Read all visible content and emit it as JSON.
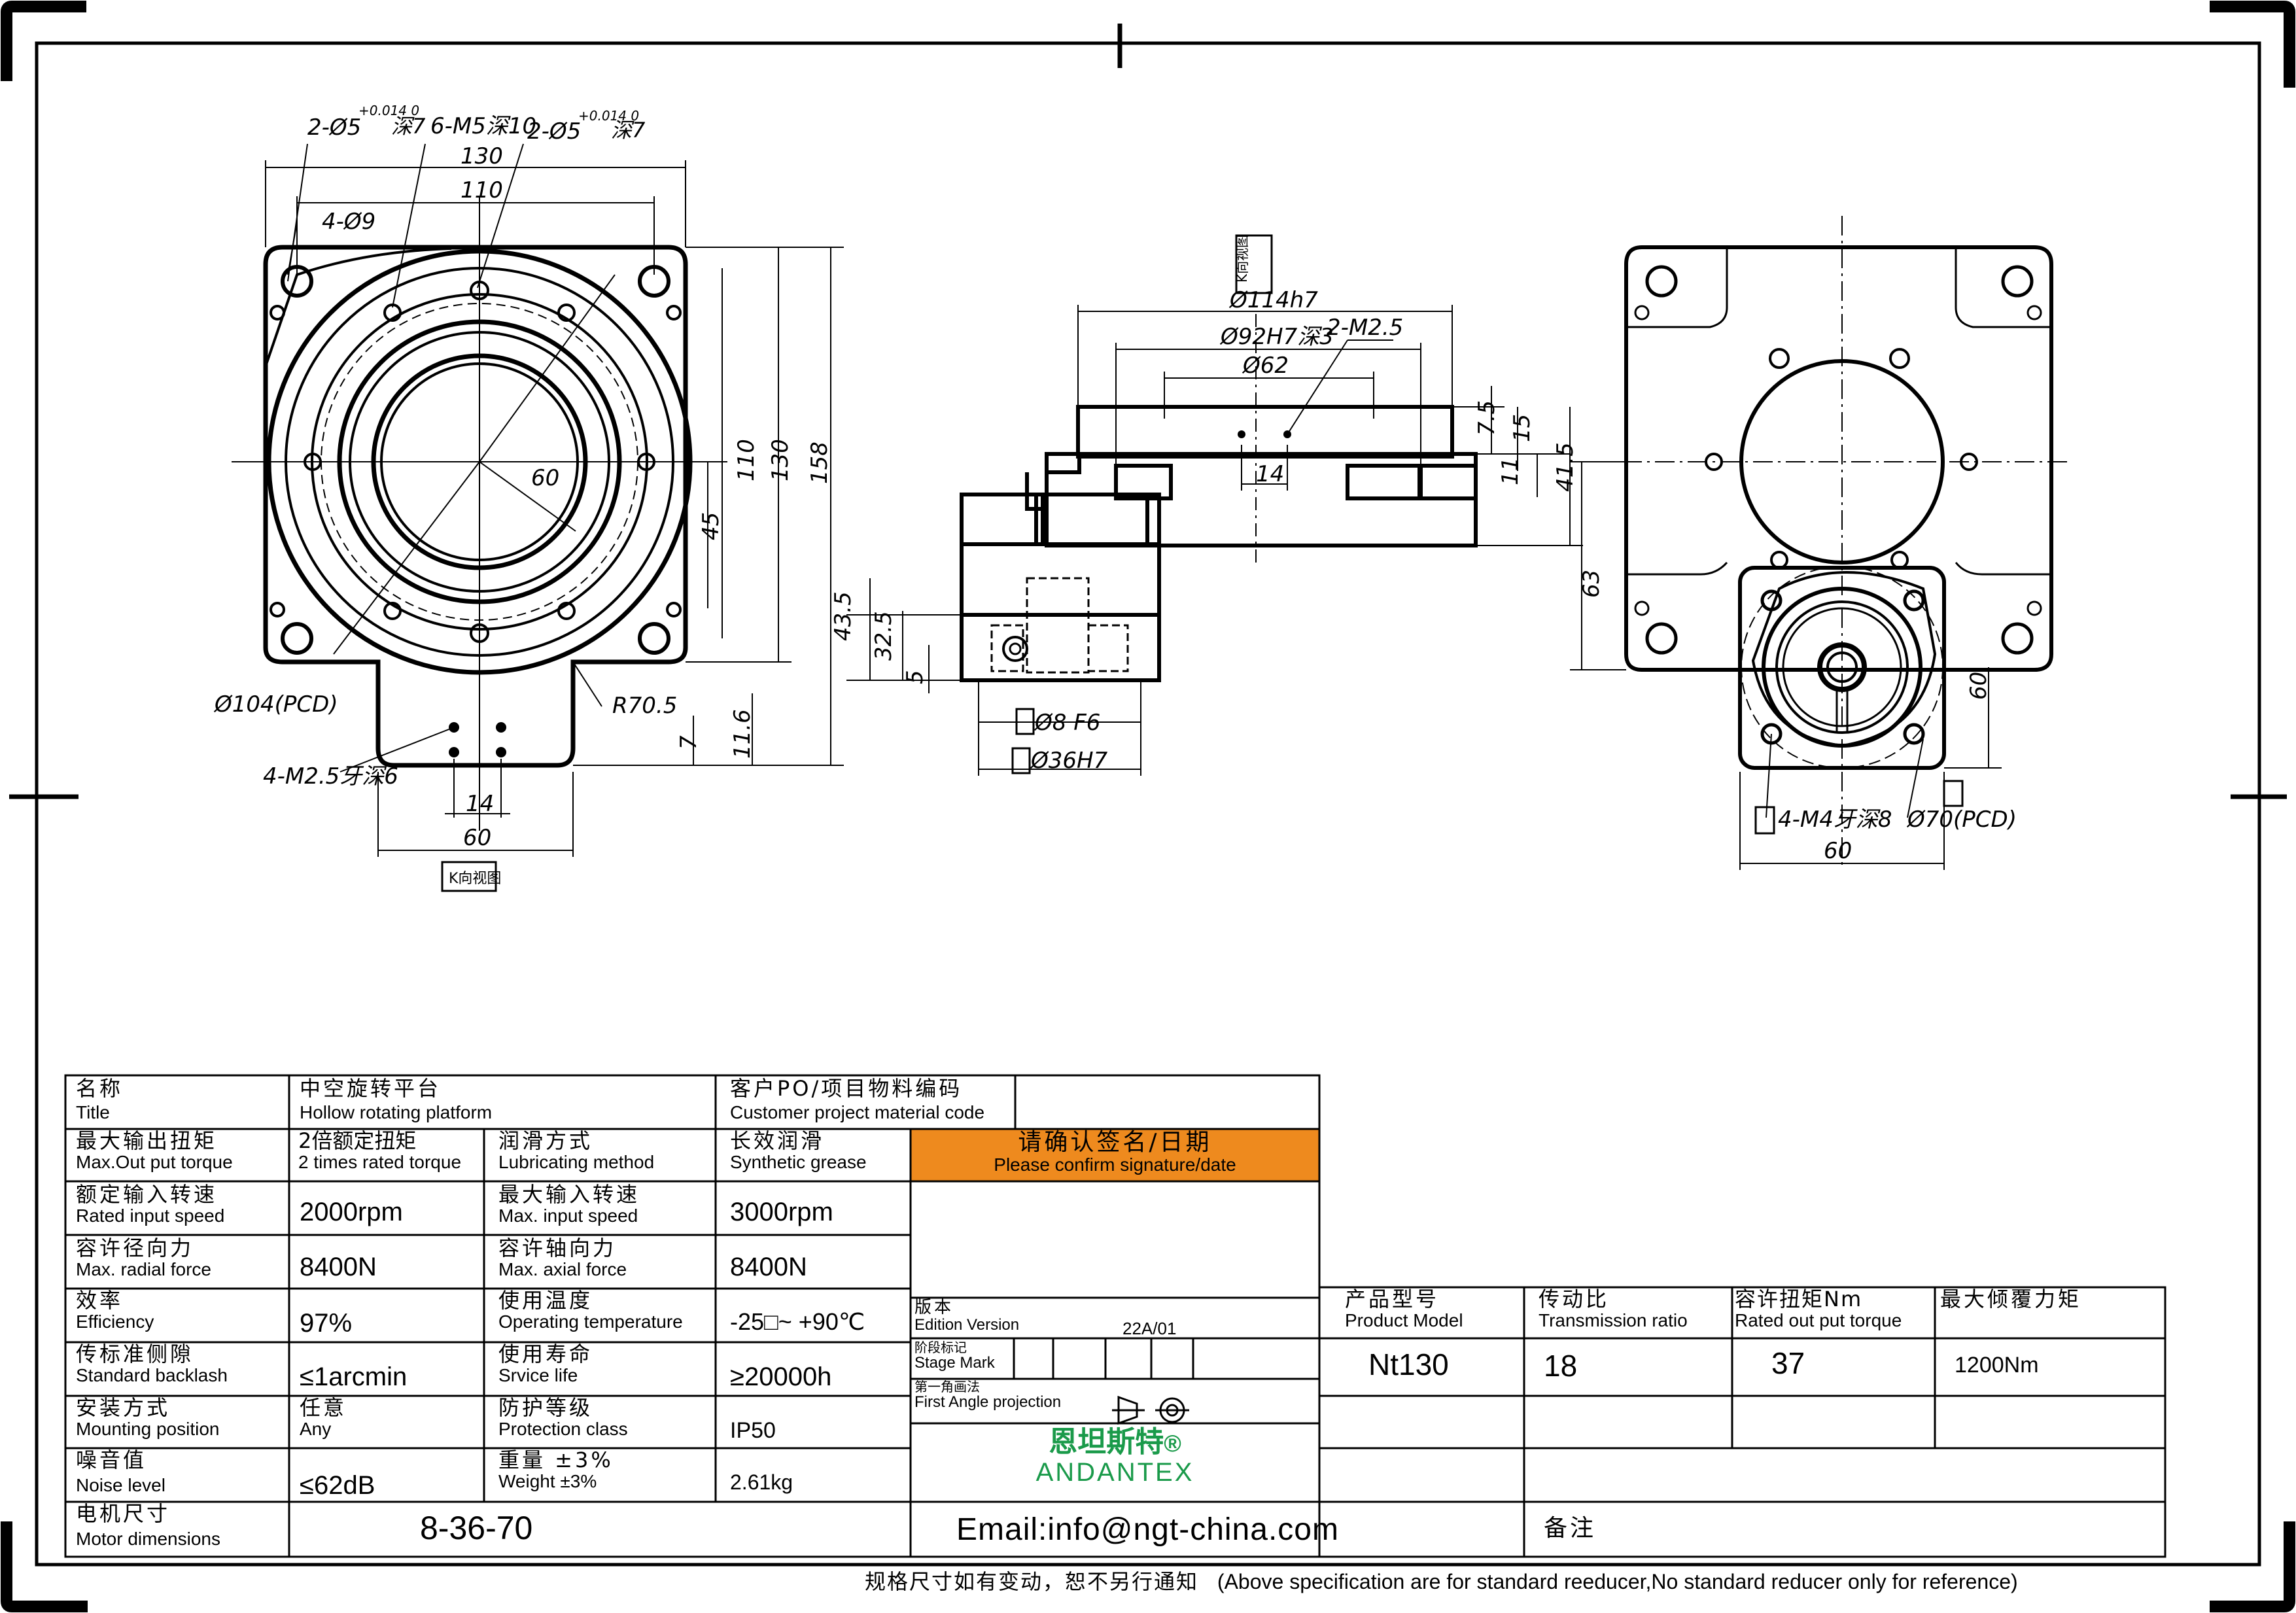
{
  "drawing_labels": {
    "hole_a": "2-Ø5",
    "hole_a_tol": "+0.014 0",
    "hole_a_depth": "深7",
    "tap_top": "6-M5深10",
    "hole_b": "2-Ø5",
    "hole_b_tol": "+0.014 0",
    "hole_b_depth": "深7",
    "dim_130_top": "130",
    "dim_110_top": "110",
    "holes_4": "4-Ø9",
    "angle_60": "60",
    "dim_45": "45",
    "dim_110_right": "110",
    "dim_130_right": "130",
    "dim_158": "158",
    "pcd_104": "Ø104(PCD)",
    "r70": "R70.5",
    "tap_m25": "4-M2.5牙深6",
    "dim_7": "7",
    "dim_11_6": "11.6",
    "dim_14_bottom": "14",
    "dim_60_bottom": "60",
    "k_view": "K向视图",
    "k_marker": "K向视图",
    "d114": "Ø114h7",
    "d92": "Ø92H7深3",
    "m25_side": "2-M2.5",
    "d62": "Ø62",
    "dim_7_5": "7.5",
    "dim_15": "15",
    "dim_11": "11",
    "dim_41_5": "41.5",
    "dim_14_side": "14",
    "dim_43_5": "43.5",
    "dim_32_5": "32.5",
    "dim_5": "5",
    "d8": "Ø8 F6",
    "d36": "Ø36H7",
    "dim_63": "63",
    "dim_60_right": "60",
    "tap_m4": "4-M4牙深8",
    "pcd_70": "Ø70(PCD)",
    "dim_60_motor": "60"
  },
  "title_block": {
    "name_cn": "名称",
    "name_en": "Title",
    "name_value_cn": "中空旋转平台",
    "name_value_en": "Hollow rotating platform",
    "po_cn": "客户PO/项目物料编码",
    "po_en": "Customer project material code",
    "confirm_cn": "请确认签名/日期",
    "confirm_en": "Please confirm signature/date",
    "specs": [
      {
        "l_cn": "最大输出扭矩",
        "l_en": "Max.Out put torque",
        "l_val_cn": "2倍额定扭矩",
        "l_val_en": "2 times rated torque",
        "r_cn": "润滑方式",
        "r_en": "Lubricating method",
        "r_val_cn": "长效润滑",
        "r_val_en": "Synthetic grease"
      },
      {
        "l_cn": "额定输入转速",
        "l_en": "Rated input speed",
        "l_val": "2000rpm",
        "r_cn": "最大输入转速",
        "r_en": "Max. input speed",
        "r_val": "3000rpm"
      },
      {
        "l_cn": "容许径向力",
        "l_en": "Max. radial force",
        "l_val": "8400N",
        "r_cn": "容许轴向力",
        "r_en": "Max. axial force",
        "r_val": "8400N"
      },
      {
        "l_cn": "效率",
        "l_en": "Efficiency",
        "l_val": "97%",
        "r_cn": "使用温度",
        "r_en": "Operating temperature",
        "r_val": "-25□~ +90℃"
      },
      {
        "l_cn": "传标准侧隙",
        "l_en": "Standard backlash",
        "l_val": "≤1arcmin",
        "r_cn": "使用寿命",
        "r_en": "Srvice life",
        "r_val": "≥20000h"
      },
      {
        "l_cn": "安装方式",
        "l_en": "Mounting position",
        "l_val_cn": "任意",
        "l_val_en": "Any",
        "r_cn": "防护等级",
        "r_en": "Protection class",
        "r_val": "IP50"
      },
      {
        "l_cn": "噪音值",
        "l_en": "Noise level",
        "l_val": "≤62dB",
        "r_cn": "重量 ±3%",
        "r_en": "Weight ±3%",
        "r_val": "2.61kg"
      }
    ],
    "motor_cn": "电机尺寸",
    "motor_en": "Motor dimensions",
    "motor_value": "8-36-70",
    "edition_cn": "版本",
    "edition_en": "Edition Version",
    "edition_value": "22A/01",
    "stage_cn": "阶段标记",
    "stage_en": "Stage Mark",
    "projection_cn": "第一角画法",
    "projection_en": "First Angle projection",
    "brand_cn": "恩坦斯特",
    "brand_mark": "®",
    "brand_en": "ANDANTEX",
    "email": "Email:info@ngt-china.com",
    "model_cn": "产品型号",
    "model_en": "Product Model",
    "model_value": "Nt130",
    "ratio_cn": "传动比",
    "ratio_en": "Transmission ratio",
    "ratio_value": "18",
    "torque_cn": "容许扭矩Nm",
    "torque_en": "Rated out put torque",
    "torque_value": "37",
    "tilt_cn": "最大倾覆力矩",
    "tilt_value": "1200Nm",
    "remark_cn": "备注"
  },
  "footer": {
    "note_cn": "规格尺寸如有变动，恕不另行通知",
    "note_en": "(Above specification are for standard reeducer,No standard reducer only for reference)"
  },
  "colors": {
    "confirm_bg": "#ee8a1e",
    "brand_green": "#1a9a4a",
    "line": "#000000"
  }
}
